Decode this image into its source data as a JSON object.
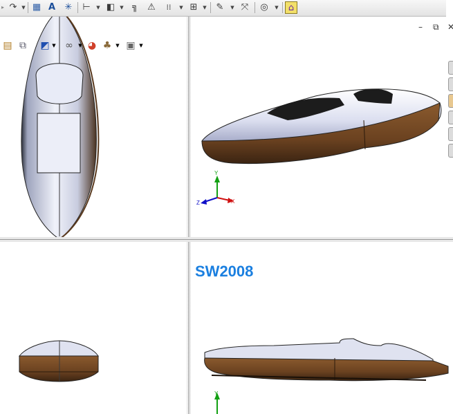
{
  "toolbar": {
    "items": [
      {
        "name": "redo-icon",
        "glyph": "↷"
      },
      {
        "name": "sketch-grid-icon",
        "glyph": "▦"
      },
      {
        "name": "text-icon",
        "glyph": "A"
      },
      {
        "name": "point-icon",
        "glyph": "✳"
      },
      {
        "name": "dimension-icon",
        "glyph": "⊢"
      },
      {
        "name": "plane-icon",
        "glyph": "◧"
      },
      {
        "name": "mirror-icon",
        "glyph": "╗"
      },
      {
        "name": "triangle-icon",
        "glyph": "⚠"
      },
      {
        "name": "pattern-icon",
        "glyph": "⁞⁞"
      },
      {
        "name": "relations-icon",
        "glyph": "⊞"
      },
      {
        "name": "smart-dimension-icon",
        "glyph": "✎"
      },
      {
        "name": "reference-geometry-icon",
        "glyph": "⤧"
      },
      {
        "name": "rebuild-icon",
        "glyph": "◎"
      },
      {
        "name": "options-icon",
        "glyph": "⌂"
      }
    ]
  },
  "viewport_top_right": {
    "window_controls": {
      "minimize": "–",
      "restore": "⧉",
      "close": "✕"
    }
  },
  "triad": {
    "y": "Y",
    "x": "X",
    "z": "Z"
  },
  "watermark": {
    "label": "SW2008"
  },
  "colors": {
    "accent": "#1a7fe0",
    "body_top": "#dfe3f2",
    "body_bottom": "#7b4d25",
    "axis_x": "#d01010",
    "axis_y": "#12a012",
    "axis_z": "#1010c8"
  }
}
